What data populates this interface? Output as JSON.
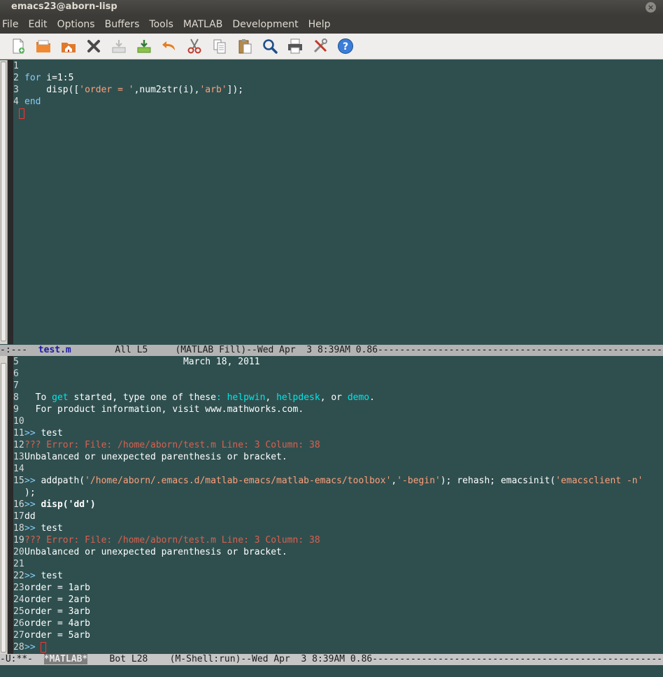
{
  "window": {
    "title": "emacs23@aborn-lisp",
    "close_glyph": "×"
  },
  "menu": [
    "File",
    "Edit",
    "Options",
    "Buffers",
    "Tools",
    "MATLAB",
    "Development",
    "Help"
  ],
  "toolbar": [
    {
      "name": "new-file-icon"
    },
    {
      "name": "open-file-icon"
    },
    {
      "name": "dired-icon"
    },
    {
      "name": "close-icon"
    },
    {
      "name": "save-icon"
    },
    {
      "name": "save-as-icon"
    },
    {
      "name": "undo-icon"
    },
    {
      "name": "cut-icon"
    },
    {
      "name": "copy-icon"
    },
    {
      "name": "paste-icon"
    },
    {
      "name": "search-icon"
    },
    {
      "name": "print-icon"
    },
    {
      "name": "preferences-icon"
    },
    {
      "name": "help-icon"
    }
  ],
  "editor": {
    "lines": [
      {
        "n": "1"
      },
      {
        "n": "2",
        "parts": [
          {
            "t": "for",
            "c": "kw"
          },
          {
            "t": " i=1:5",
            "c": ""
          }
        ]
      },
      {
        "n": "3",
        "parts": [
          {
            "t": "    disp([",
            "c": ""
          },
          {
            "t": "'order = '",
            "c": "str"
          },
          {
            "t": ",num2str(i),",
            "c": ""
          },
          {
            "t": "'arb'",
            "c": "str"
          },
          {
            "t": "]);",
            "c": ""
          }
        ]
      },
      {
        "n": "4",
        "parts": [
          {
            "t": "end",
            "c": "kw"
          }
        ]
      }
    ]
  },
  "modeline_top": {
    "left": "-:---  ",
    "buffer": "test.m",
    "right": "        All L5     (MATLAB Fill)--Wed Apr  3 8:39AM 0.86----------------------------------------------------------------"
  },
  "shell": {
    "lines": [
      {
        "n": "5",
        "parts": [
          {
            "t": "                             March 18, 2011",
            "c": ""
          }
        ]
      },
      {
        "n": "6"
      },
      {
        "n": "7"
      },
      {
        "n": "8",
        "parts": [
          {
            "t": "  To ",
            "c": ""
          },
          {
            "t": "get",
            "c": "link"
          },
          {
            "t": " started, type one of these",
            "c": ""
          },
          {
            "t": ":",
            "c": "link"
          },
          {
            "t": " ",
            "c": ""
          },
          {
            "t": "helpwin",
            "c": "link"
          },
          {
            "t": ", ",
            "c": ""
          },
          {
            "t": "helpdesk",
            "c": "link"
          },
          {
            "t": ", or ",
            "c": ""
          },
          {
            "t": "demo",
            "c": "link"
          },
          {
            "t": ".",
            "c": ""
          }
        ]
      },
      {
        "n": "9",
        "parts": [
          {
            "t": "  For product information, visit www.mathworks.com.",
            "c": ""
          }
        ]
      },
      {
        "n": "10"
      },
      {
        "n": "11",
        "parts": [
          {
            "t": ">>",
            "c": "prompt"
          },
          {
            "t": " test",
            "c": ""
          }
        ]
      },
      {
        "n": "12",
        "parts": [
          {
            "t": "??? Error: File: /home/aborn/test.m Line: 3 Column: 38",
            "c": "err"
          }
        ]
      },
      {
        "n": "13",
        "parts": [
          {
            "t": "Unbalanced or unexpected parenthesis or bracket.",
            "c": ""
          }
        ]
      },
      {
        "n": "14"
      },
      {
        "n": "15",
        "parts": [
          {
            "t": ">>",
            "c": "prompt"
          },
          {
            "t": " addpath(",
            "c": ""
          },
          {
            "t": "'/home/aborn/.emacs.d/matlab-emacs/matlab-emacs/toolbox'",
            "c": "str"
          },
          {
            "t": ",",
            "c": ""
          },
          {
            "t": "'-begin'",
            "c": "str"
          },
          {
            "t": "); rehash; emacsinit(",
            "c": ""
          },
          {
            "t": "'emacsclient -n'",
            "c": "str"
          }
        ]
      },
      {
        "n": "",
        "parts": [
          {
            "t": ");",
            "c": ""
          }
        ]
      },
      {
        "n": "16",
        "parts": [
          {
            "t": ">>",
            "c": "prompt"
          },
          {
            "t": " disp('dd')",
            "c": "bold"
          }
        ]
      },
      {
        "n": "17",
        "parts": [
          {
            "t": "dd",
            "c": ""
          }
        ]
      },
      {
        "n": "18",
        "parts": [
          {
            "t": ">>",
            "c": "prompt"
          },
          {
            "t": " test",
            "c": ""
          }
        ]
      },
      {
        "n": "19",
        "parts": [
          {
            "t": "??? Error: File: /home/aborn/test.m Line: 3 Column: 38",
            "c": "err"
          }
        ]
      },
      {
        "n": "20",
        "parts": [
          {
            "t": "Unbalanced or unexpected parenthesis or bracket.",
            "c": ""
          }
        ]
      },
      {
        "n": "21"
      },
      {
        "n": "22",
        "parts": [
          {
            "t": ">>",
            "c": "prompt"
          },
          {
            "t": " test",
            "c": ""
          }
        ]
      },
      {
        "n": "23",
        "parts": [
          {
            "t": "order = 1arb",
            "c": ""
          }
        ]
      },
      {
        "n": "24",
        "parts": [
          {
            "t": "order = 2arb",
            "c": ""
          }
        ]
      },
      {
        "n": "25",
        "parts": [
          {
            "t": "order = 3arb",
            "c": ""
          }
        ]
      },
      {
        "n": "26",
        "parts": [
          {
            "t": "order = 4arb",
            "c": ""
          }
        ]
      },
      {
        "n": "27",
        "parts": [
          {
            "t": "order = 5arb",
            "c": ""
          }
        ]
      },
      {
        "n": "28",
        "parts": [
          {
            "t": ">>",
            "c": "prompt"
          },
          {
            "t": " ",
            "c": ""
          }
        ]
      }
    ]
  },
  "modeline_bottom": {
    "left": "-U:**-  ",
    "buffer": "*MATLAB*",
    "right": "    Bot L28    (M-Shell:run)--Wed Apr  3 8:39AM 0.86----------------------------------------------------------------"
  }
}
